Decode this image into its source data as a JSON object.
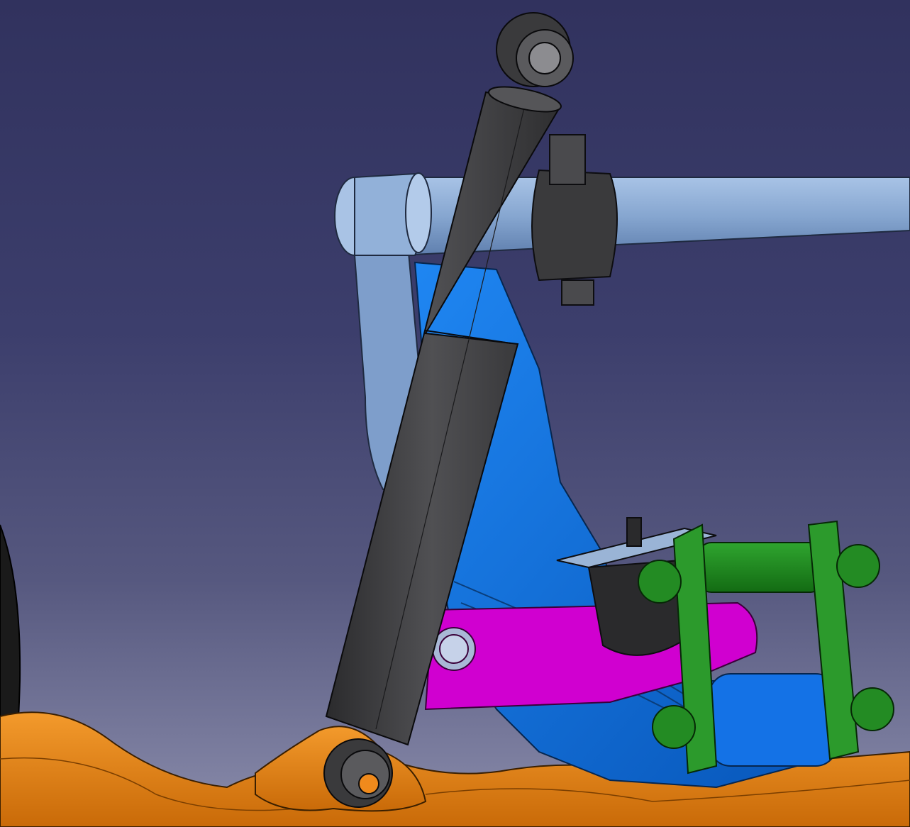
{
  "viewport": {
    "background_top": "#31325e",
    "background_bottom": "#8a8cab"
  },
  "parts": {
    "shock_absorber": {
      "color": "#3d3d3f"
    },
    "upper_control_arm": {
      "color": "#8fb0d8"
    },
    "leaf_spring_bracket": {
      "color": "#0a6fe0"
    },
    "spring_seat": {
      "color": "#d400d4"
    },
    "shackle": {
      "color": "#1e8a1e"
    },
    "bump_stop": {
      "color": "#2a2a2c"
    },
    "frame_rail": {
      "color": "#e8820c"
    },
    "tire": {
      "color": "#1a1a1a"
    }
  }
}
